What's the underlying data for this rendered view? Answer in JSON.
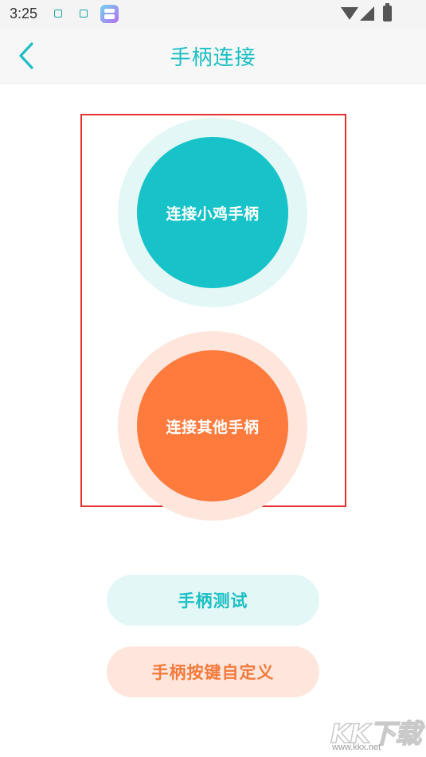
{
  "status_bar": {
    "time": "3:25",
    "icons": [
      "notification-icon",
      "notification-icon",
      "app-store-icon",
      "wifi-icon",
      "cellular-signal-icon",
      "battery-charging-icon"
    ]
  },
  "header": {
    "title": "手柄连接",
    "back_icon": "chevron-left-icon"
  },
  "connect_options": [
    {
      "label": "连接小鸡手柄",
      "color": "#17c3c8",
      "halo_color": "#e3f7f7"
    },
    {
      "label": "连接其他手柄",
      "color": "#ff7a3d",
      "halo_color": "#ffe6dc"
    }
  ],
  "actions": {
    "test_label": "手柄测试",
    "test_text_color": "#1bbfc4",
    "test_bg_color": "#e3f7f7",
    "custom_keys_label": "手柄按键自定义",
    "custom_keys_text_color": "#f47a3c",
    "custom_keys_bg_color": "#ffe6dc"
  },
  "highlight_color": "#e3332f",
  "watermark": {
    "mark": "KK下载",
    "url": "www.kkx.net"
  }
}
